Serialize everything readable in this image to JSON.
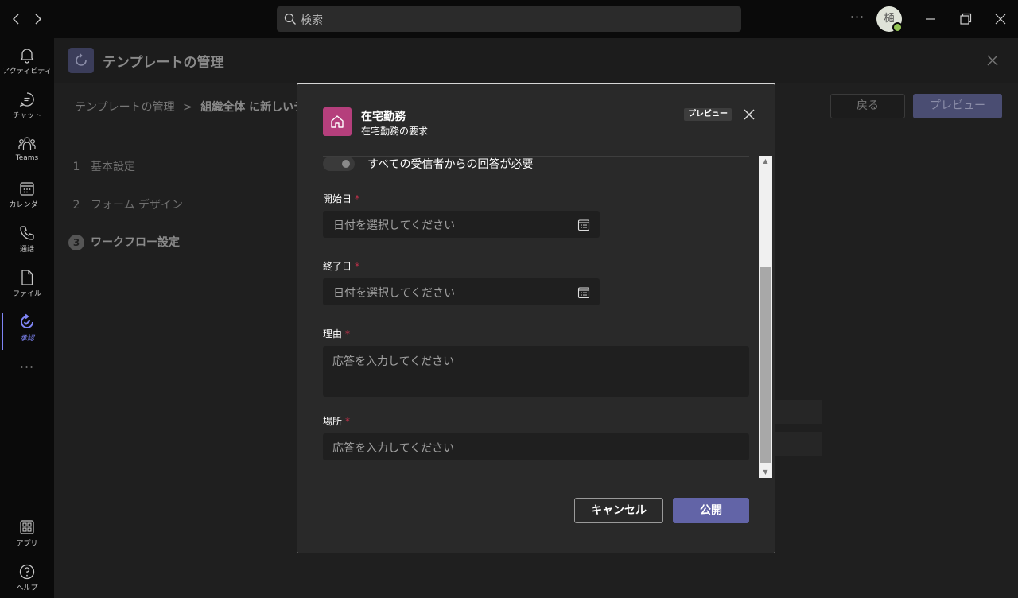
{
  "topbar": {
    "search_placeholder": "検索",
    "more_label": "···",
    "avatar_initial": "樋"
  },
  "rail": {
    "items": [
      {
        "label": "アクティビティ",
        "icon": "bell-icon"
      },
      {
        "label": "チャット",
        "icon": "chat-icon"
      },
      {
        "label": "Teams",
        "icon": "teams-icon"
      },
      {
        "label": "カレンダー",
        "icon": "calendar-icon"
      },
      {
        "label": "通話",
        "icon": "phone-icon"
      },
      {
        "label": "ファイル",
        "icon": "file-icon"
      },
      {
        "label": "承認",
        "icon": "approvals-icon"
      },
      {
        "label": "アプリ",
        "icon": "apps-icon"
      },
      {
        "label": "ヘルプ",
        "icon": "help-icon"
      }
    ],
    "more_label": "···"
  },
  "app": {
    "title": "テンプレートの管理",
    "breadcrumb": {
      "root": "テンプレートの管理",
      "separator": ">",
      "current": "組織全体 に新しいテ"
    },
    "back_label": "戻る",
    "preview_label": "プレビュー",
    "steps": [
      {
        "num": "1",
        "label": "基本設定"
      },
      {
        "num": "2",
        "label": "フォーム デザイン"
      },
      {
        "num": "3",
        "label": "ワークフロー設定"
      }
    ]
  },
  "modal": {
    "title": "在宅勤務",
    "subtitle": "在宅勤務の要求",
    "badge": "プレビュー",
    "toggle_label": "すべての受信者からの回答が必要",
    "fields": {
      "start": {
        "label": "開始日",
        "required": "*",
        "placeholder": "日付を選択してください"
      },
      "end": {
        "label": "終了日",
        "required": "*",
        "placeholder": "日付を選択してください"
      },
      "reason": {
        "label": "理由",
        "required": "*",
        "placeholder": "応答を入力してください"
      },
      "location": {
        "label": "場所",
        "required": "*",
        "placeholder": "応答を入力してください"
      }
    },
    "cancel_label": "キャンセル",
    "publish_label": "公開"
  },
  "colors": {
    "accent": "#6264a7",
    "app_icon": "#b53f7c",
    "required": "#c4314b",
    "presence": "#92c353"
  }
}
